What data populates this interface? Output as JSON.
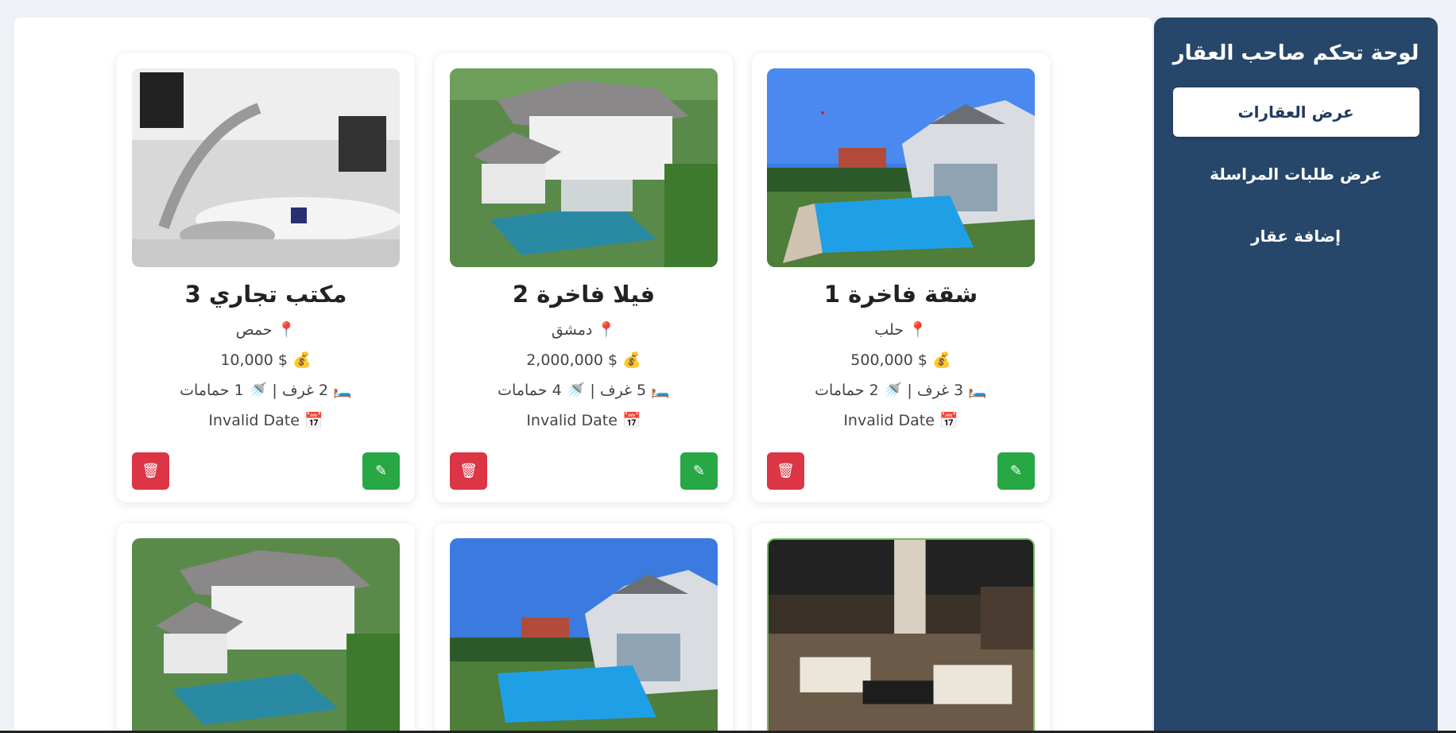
{
  "sidebar": {
    "title": "لوحة تحكم صاحب العقار",
    "items": [
      {
        "label": "عرض العقارات",
        "active": true
      },
      {
        "label": "عرض طلبات المراسلة",
        "active": false
      },
      {
        "label": "إضافة عقار",
        "active": false
      }
    ]
  },
  "cards": [
    {
      "title": "شقة فاخرة 1",
      "location": "حلب",
      "price": "$ 500,000",
      "rooms_text": "3 غرف",
      "baths_text": "2 حمامات",
      "date": "Invalid Date"
    },
    {
      "title": "فيلا فاخرة 2",
      "location": "دمشق",
      "price": "$ 2,000,000",
      "rooms_text": "5 غرف",
      "baths_text": "4 حمامات",
      "date": "Invalid Date"
    },
    {
      "title": "مكتب تجاري 3",
      "location": "حمص",
      "price": "$ 10,000",
      "rooms_text": "2 غرف",
      "baths_text": "1 حمامات",
      "date": "Invalid Date"
    }
  ],
  "icons": {
    "location": "📍",
    "price": "💰",
    "rooms": "🛏️",
    "baths": "🚿",
    "date": "📅",
    "edit": "✎",
    "delete": "🗑"
  },
  "colors": {
    "sidebar_bg": "#27476a",
    "edit_btn": "#28a745",
    "delete_btn": "#dc3545"
  }
}
